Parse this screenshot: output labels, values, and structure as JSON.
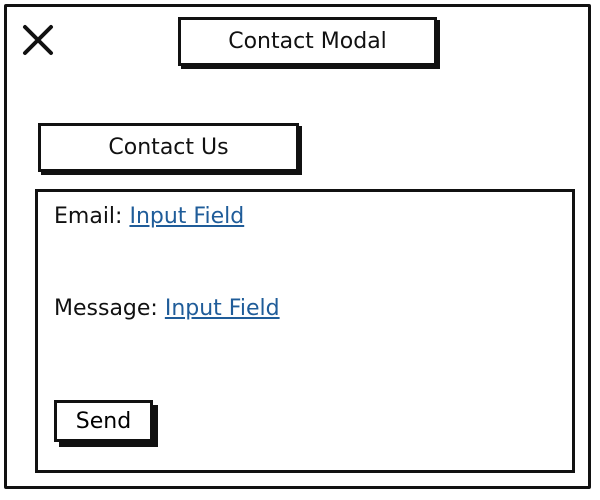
{
  "modal": {
    "title": "Contact Modal",
    "close_icon": "close-icon"
  },
  "form": {
    "heading": "Contact Us",
    "email_label": "Email:",
    "email_placeholder": "Input Field",
    "message_label": "Message:",
    "message_placeholder": "Input Field",
    "send_label": "Send"
  }
}
